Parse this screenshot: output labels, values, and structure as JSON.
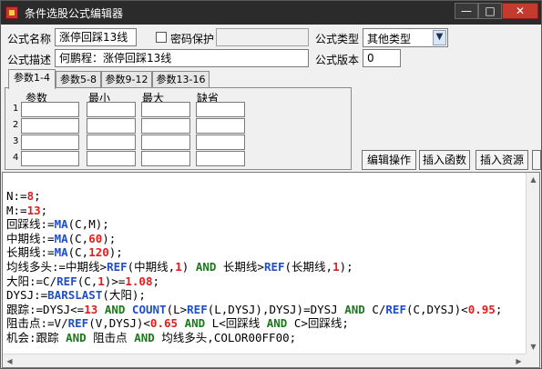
{
  "window": {
    "title": "条件选股公式编辑器",
    "minimize_label": "—",
    "maximize_label": "□",
    "close_label": "✕"
  },
  "form": {
    "name_label": "公式名称",
    "name_value": "涨停回踩13线",
    "password_label": "密码保护",
    "type_label": "公式类型",
    "type_value": "其他类型",
    "desc_label": "公式描述",
    "desc_value": "何鹏程：涨停回踩13线",
    "version_label": "公式版本",
    "version_value": "0"
  },
  "tabs": [
    "参数1-4",
    "参数5-8",
    "参数9-12",
    "参数13-16"
  ],
  "params": {
    "headers": [
      "参数",
      "最小",
      "最大",
      "缺省"
    ],
    "rows": [
      "1",
      "2",
      "3",
      "4"
    ]
  },
  "buttons": {
    "edit_ops": "编辑操作",
    "insert_func": "插入函数",
    "insert_res": "插入资源"
  },
  "code": {
    "lines": [
      [
        [
          "t",
          "N:="
        ],
        [
          "n",
          "8"
        ],
        [
          "t",
          ";"
        ]
      ],
      [
        [
          "t",
          "M:="
        ],
        [
          "n",
          "13"
        ],
        [
          "t",
          ";"
        ]
      ],
      [
        [
          "t",
          "回踩线:="
        ],
        [
          "f",
          "MA"
        ],
        [
          "t",
          "(C,M);"
        ]
      ],
      [
        [
          "t",
          "中期线:="
        ],
        [
          "f",
          "MA"
        ],
        [
          "t",
          "(C,"
        ],
        [
          "n",
          "60"
        ],
        [
          "t",
          ");"
        ]
      ],
      [
        [
          "t",
          "长期线:="
        ],
        [
          "f",
          "MA"
        ],
        [
          "t",
          "(C,"
        ],
        [
          "n",
          "120"
        ],
        [
          "t",
          ");"
        ]
      ],
      [
        [
          "t",
          "均线多头:=中期线>"
        ],
        [
          "f",
          "REF"
        ],
        [
          "t",
          "(中期线,"
        ],
        [
          "n",
          "1"
        ],
        [
          "t",
          ") "
        ],
        [
          "k",
          "AND"
        ],
        [
          "t",
          " 长期线>"
        ],
        [
          "f",
          "REF"
        ],
        [
          "t",
          "(长期线,"
        ],
        [
          "n",
          "1"
        ],
        [
          "t",
          ");"
        ]
      ],
      [
        [
          "t",
          "大阳:=C/"
        ],
        [
          "f",
          "REF"
        ],
        [
          "t",
          "(C,"
        ],
        [
          "n",
          "1"
        ],
        [
          "t",
          ")>="
        ],
        [
          "n",
          "1.08"
        ],
        [
          "t",
          ";"
        ]
      ],
      [
        [
          "t",
          "DYSJ:="
        ],
        [
          "f",
          "BARSLAST"
        ],
        [
          "t",
          "(大阳);"
        ]
      ],
      [
        [
          "t",
          "跟踪:=DYSJ<="
        ],
        [
          "n",
          "13"
        ],
        [
          "t",
          " "
        ],
        [
          "k",
          "AND"
        ],
        [
          "t",
          " "
        ],
        [
          "f",
          "COUNT"
        ],
        [
          "t",
          "(L>"
        ],
        [
          "f",
          "REF"
        ],
        [
          "t",
          "(L,DYSJ),DYSJ)=DYSJ "
        ],
        [
          "k",
          "AND"
        ],
        [
          "t",
          " C/"
        ],
        [
          "f",
          "REF"
        ],
        [
          "t",
          "(C,DYSJ)<"
        ],
        [
          "n",
          "0.95"
        ],
        [
          "t",
          ";"
        ]
      ],
      [
        [
          "t",
          "阻击点:=V/"
        ],
        [
          "f",
          "REF"
        ],
        [
          "t",
          "(V,DYSJ)<"
        ],
        [
          "n",
          "0.65"
        ],
        [
          "t",
          " "
        ],
        [
          "k",
          "AND"
        ],
        [
          "t",
          " L<回踩线 "
        ],
        [
          "k",
          "AND"
        ],
        [
          "t",
          " C>回踩线;"
        ]
      ],
      [
        [
          "t",
          "机会:跟踪 "
        ],
        [
          "k",
          "AND"
        ],
        [
          "t",
          " 阻击点 "
        ],
        [
          "k",
          "AND"
        ],
        [
          "t",
          " 均线多头,COLOR00FF00;"
        ]
      ]
    ]
  }
}
